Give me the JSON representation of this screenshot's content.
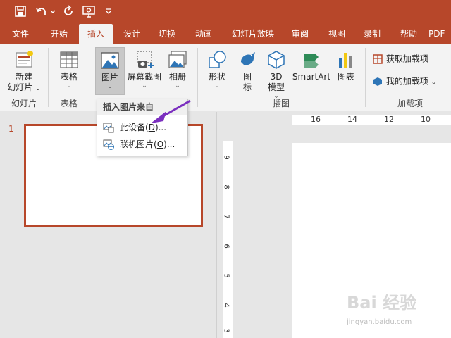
{
  "quick_access": {
    "save_icon": "save-icon",
    "undo_icon": "undo-icon",
    "redo_icon": "redo-icon",
    "present_icon": "present-from-start-icon",
    "customize_icon": "customize-qat-icon"
  },
  "tabs": [
    {
      "label": "文件"
    },
    {
      "label": "开始"
    },
    {
      "label": "插入"
    },
    {
      "label": "设计"
    },
    {
      "label": "切换"
    },
    {
      "label": "动画"
    },
    {
      "label": "幻灯片放映"
    },
    {
      "label": "审阅"
    },
    {
      "label": "视图"
    },
    {
      "label": "录制"
    },
    {
      "label": "帮助"
    },
    {
      "label": "PDF"
    }
  ],
  "ribbon": {
    "new_slide": {
      "line1": "新建",
      "line2": "幻灯片",
      "chevron": "⌄"
    },
    "group_slides": "幻灯片",
    "table": {
      "label": "表格",
      "chevron": "⌄"
    },
    "group_table": "表格",
    "pictures": {
      "label": "图片",
      "chevron": "⌄"
    },
    "screenshot": {
      "label": "屏幕截图",
      "chevron": "⌄"
    },
    "album": {
      "label": "相册",
      "chevron": "⌄"
    },
    "shapes": {
      "label": "形状",
      "chevron": "⌄"
    },
    "icons": {
      "line1": "图",
      "line2": "标"
    },
    "models3d": {
      "line1": "3D",
      "line2": "模型",
      "chevron": "⌄"
    },
    "smartart": {
      "label": "SmartArt"
    },
    "chart": {
      "label": "图表"
    },
    "group_illustrations": "插图",
    "get_addins": {
      "label": "获取加载项"
    },
    "my_addins": {
      "label": "我的加载项",
      "chevron": "⌄"
    },
    "group_addins": "加载项"
  },
  "dropdown": {
    "header": "插入图片来自",
    "items": [
      {
        "label": "此设备(",
        "key": "D",
        "suffix": ")..."
      },
      {
        "label": "联机图片(",
        "key": "O",
        "suffix": ")..."
      }
    ]
  },
  "slides_pane": {
    "slide_number": "1"
  },
  "ruler": {
    "h_numbers": [
      "16",
      "14",
      "12",
      "10"
    ],
    "v_numbers": [
      "9",
      "8",
      "7",
      "6",
      "5",
      "4",
      "3"
    ]
  },
  "watermark": {
    "text": "Bai 经验",
    "url": "jingyan.baidu.com"
  },
  "colors": {
    "accent": "#b7472a",
    "arrow": "#7b2fbf"
  }
}
